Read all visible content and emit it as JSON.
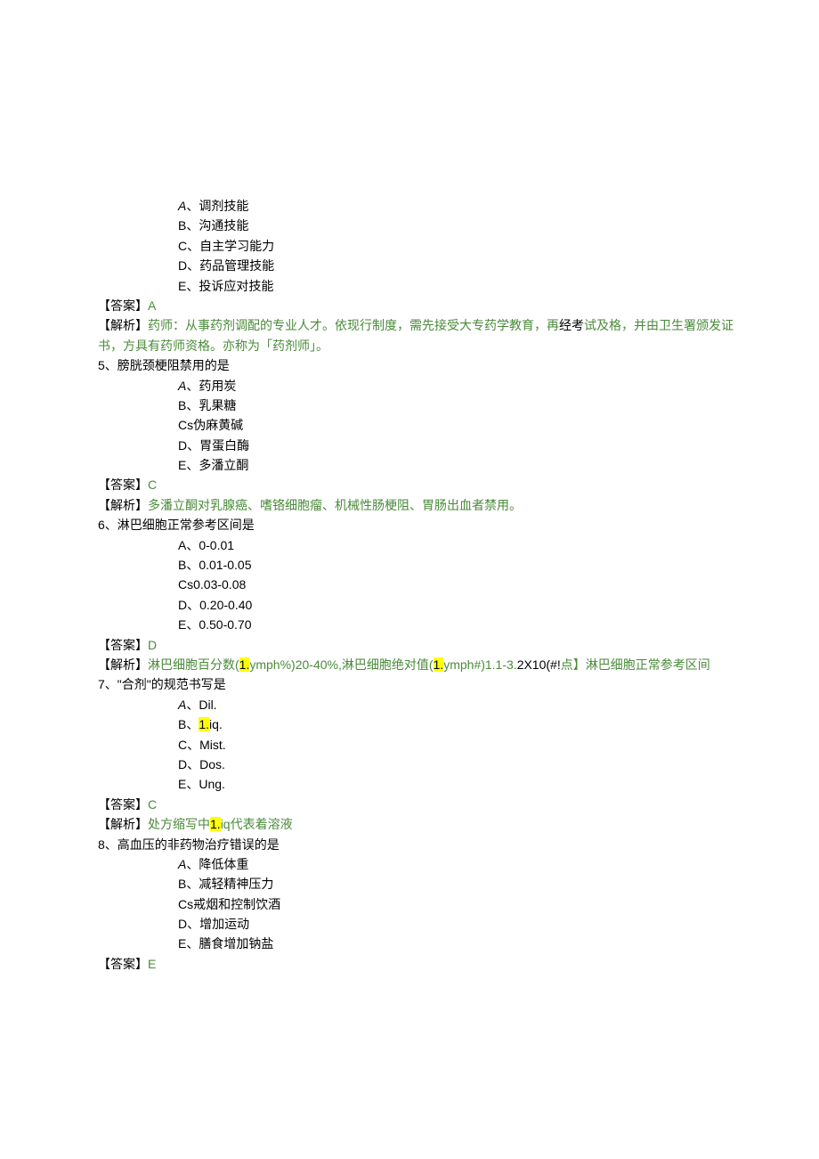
{
  "q4": {
    "options": {
      "a_prefix": "A",
      "a": "、调剂技能",
      "b": "B、沟通技能",
      "c": "C、自主学习能力",
      "d": "D、药品管理技能",
      "e": "E、投诉应对技能"
    },
    "answer_label": "【答案】",
    "answer_value": "A",
    "analysis_label": "【解析】",
    "analysis_text_1": "药师：从事药剂调配的专业人才。依现行制度，需先接受大专药学教育，再",
    "analysis_text_2": "经考",
    "analysis_text_3": "试及格，并由卫生署颁发证书，方具有药师资格。亦称为「药剂师」。"
  },
  "q5": {
    "stem": "5、膀胱颈梗阻禁用的是",
    "options": {
      "a_prefix": "A",
      "a": "、药用炭",
      "b": "B、乳果糖",
      "c": "Cs伪麻黄碱",
      "d": "D、胃蛋白酶",
      "e": "E、多潘立酮"
    },
    "answer_label": "【答案】",
    "answer_value": "C",
    "analysis_label": "【解析】",
    "analysis_text": "多潘立酮对乳腺癌、嗜铬细胞瘤、机械性肠梗阻、胃肠出血者禁用。"
  },
  "q6": {
    "stem": "6、淋巴细胞正常参考区间是",
    "options": {
      "a": "A、0-0.01",
      "b": "B、0.01-0.05",
      "c": "Cs0.03-0.08",
      "d": "D、0.20-0.40",
      "e": "E、0.50-0.70"
    },
    "answer_label": "【答案】",
    "answer_value": "D",
    "analysis_label": "【解析】",
    "analysis_p1": "淋巴细胞百分数(",
    "analysis_hl1": "1.",
    "analysis_p2": "ymph%)20-40%,淋巴细胞绝对值(",
    "analysis_hl2": "1.",
    "analysis_p3": "ymph#)1.1-3.",
    "analysis_p4": "2X10(#!",
    "analysis_p5": "点】淋巴细胞正常参考区间"
  },
  "q7": {
    "stem": "7、\"合剂\"的规范书写是",
    "options": {
      "a_prefix": "A",
      "a": "、Dil.",
      "b_pre": "B、",
      "b_hl": "1.",
      "b_post": "iq.",
      "c": "C、Mist.",
      "d": "D、Dos.",
      "e": "E、Ung."
    },
    "answer_label": "【答案】",
    "answer_value": "C",
    "analysis_label": "【解析】",
    "analysis_p1": "处方缩写中",
    "analysis_hl": "1.",
    "analysis_p2": "iq代表着溶液"
  },
  "q8": {
    "stem": "8、高血压的非药物治疗错误的是",
    "options": {
      "a_prefix": "A",
      "a": "、降低体重",
      "b": "B、减轻精神压力",
      "c": "Cs戒烟和控制饮酒",
      "d": "D、增加运动",
      "e": "E、膳食增加钠盐"
    },
    "answer_label": "【答案】",
    "answer_value": "E"
  }
}
